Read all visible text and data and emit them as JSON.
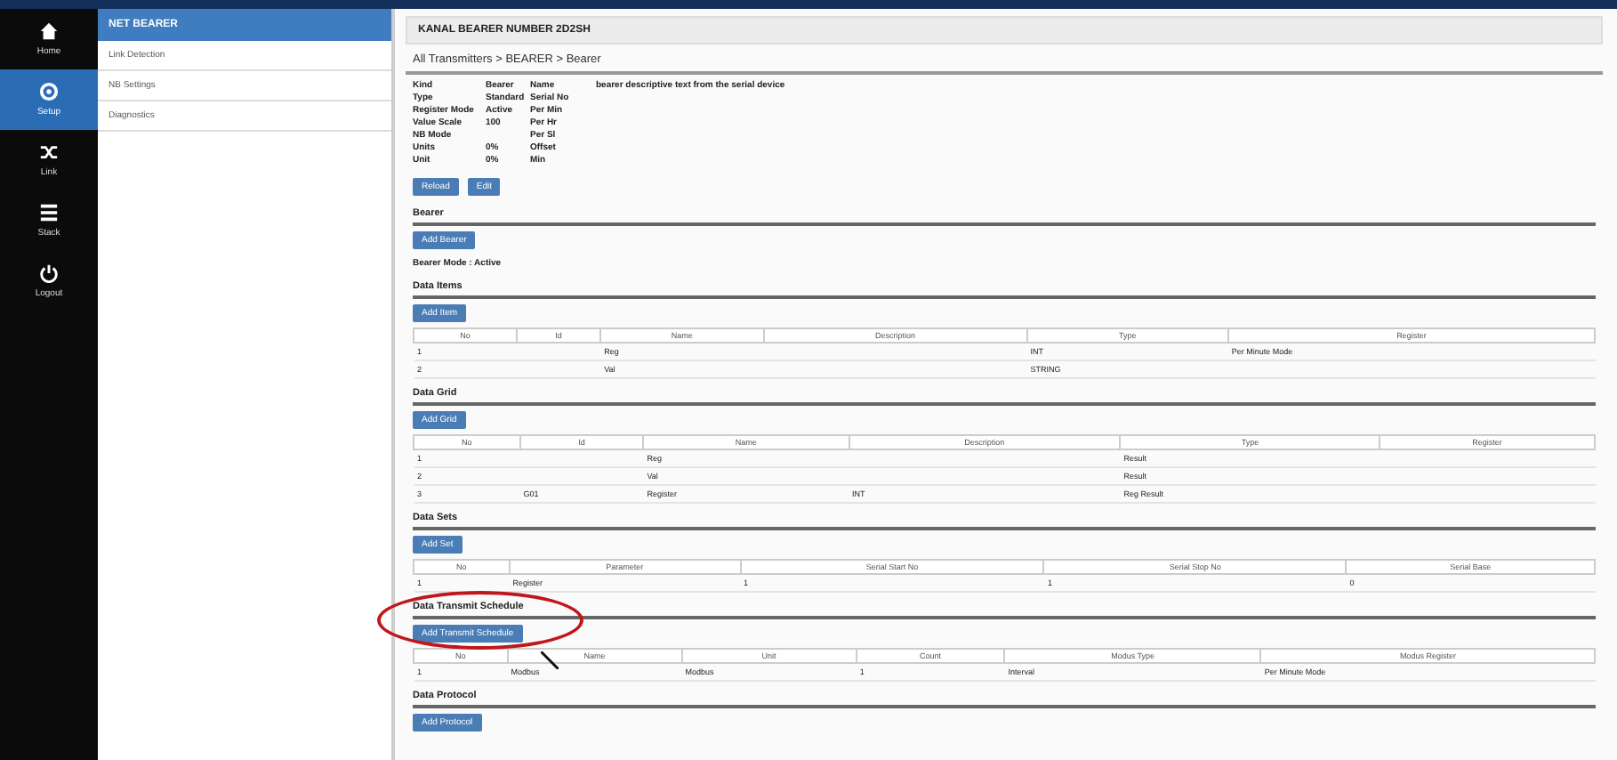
{
  "nav": [
    {
      "label": "Home",
      "kind": "home",
      "selected": false
    },
    {
      "label": "Setup",
      "kind": "gear",
      "selected": true
    },
    {
      "label": "Link",
      "kind": "shuffle",
      "selected": false
    },
    {
      "label": "Stack",
      "kind": "list",
      "selected": false
    },
    {
      "label": "Logout",
      "kind": "power",
      "selected": false
    }
  ],
  "submenu": {
    "title": "NET BEARER",
    "items": [
      "Link Detection",
      "NB Settings",
      "Diagnostics"
    ]
  },
  "page": {
    "title": "KANAL BEARER NUMBER 2D2SH",
    "breadcrumb": "All Transmitters > BEARER > Bearer",
    "info": [
      {
        "label": "Kind",
        "value": "Bearer",
        "label2": "Name",
        "value2": "bearer descriptive text from the serial device"
      },
      {
        "label": "Type",
        "value": "Standard",
        "label2": "Serial No"
      },
      {
        "label": "Register Mode",
        "value": "Active",
        "label2": "Per Min"
      },
      {
        "label": "Value Scale",
        "value": "100",
        "label2": "Per Hr"
      },
      {
        "label": "NB Mode",
        "label2": "Per Sl"
      },
      {
        "label": "Units",
        "value": "0%",
        "label2": "Offset"
      },
      {
        "label": "Unit",
        "value": "0%",
        "label2": "Min"
      }
    ],
    "buttons": [
      "Reload",
      "Edit"
    ]
  },
  "sections": [
    {
      "title": "Bearer",
      "button": "Add Bearer",
      "note": "Bearer Mode : Active"
    },
    {
      "title": "Data Items",
      "button": "Add Item",
      "table": {
        "columns": [
          "No",
          "Id",
          "Name",
          "Description",
          "Type",
          "Register"
        ],
        "rows": [
          [
            "1",
            "",
            "Reg",
            "",
            "INT",
            "Per Minute Mode"
          ],
          [
            "2",
            "",
            "Val",
            "",
            "STRING",
            ""
          ]
        ]
      }
    },
    {
      "title": "Data Grid",
      "button": "Add Grid",
      "table": {
        "columns": [
          "No",
          "Id",
          "Name",
          "Description",
          "Type",
          "Register"
        ],
        "rows": [
          [
            "1",
            "",
            "Reg",
            "",
            "Result",
            ""
          ],
          [
            "2",
            "",
            "Val",
            "",
            "Result",
            ""
          ],
          [
            "3",
            "G01",
            "Register",
            "INT",
            "Reg Result",
            ""
          ]
        ]
      }
    },
    {
      "title": "Data Sets",
      "button": "Add Set",
      "table": {
        "columns": [
          "No",
          "Parameter",
          "Serial Start No",
          "Serial Stop No",
          "Serial Base"
        ],
        "rows": [
          [
            "1",
            "Register",
            "1",
            "1",
            "0"
          ]
        ]
      }
    },
    {
      "title": "Data Transmit Schedule",
      "button": "Add Transmit Schedule",
      "annotated": true,
      "table": {
        "columns": [
          "No",
          "Name",
          "Unit",
          "Count",
          "Modus Type",
          "Modus Register"
        ],
        "rows": [
          [
            "1",
            "Modbus",
            "Modbus",
            "1",
            "Interval",
            "Per Minute Mode"
          ]
        ]
      }
    },
    {
      "title": "Data Protocol",
      "button": "Add Protocol",
      "annotated": false
    }
  ]
}
